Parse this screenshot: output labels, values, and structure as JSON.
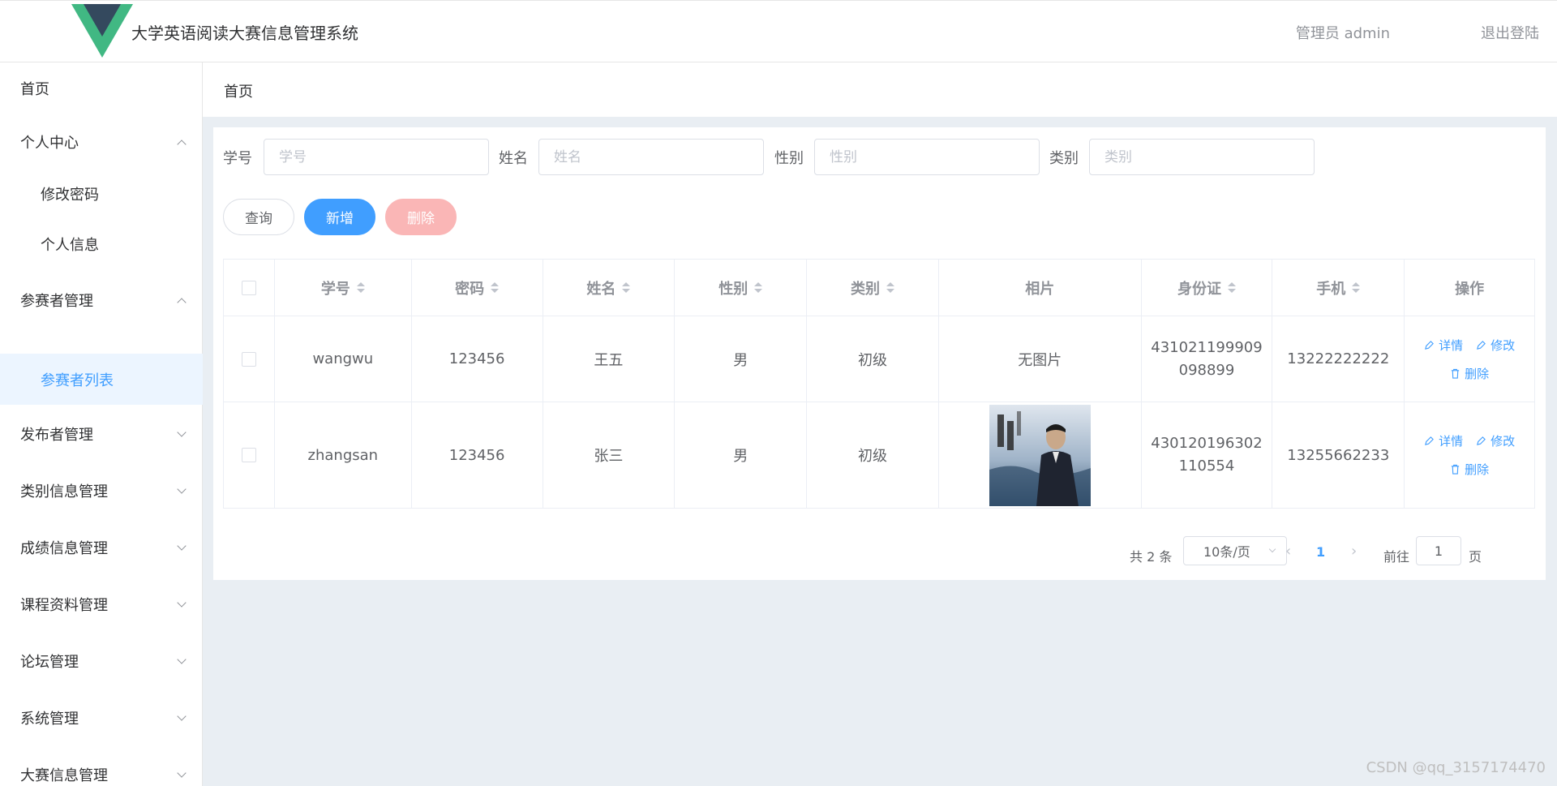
{
  "header": {
    "title": "大学英语阅读大赛信息管理系统",
    "admin_label": "管理员 admin",
    "logout_label": "退出登陆",
    "logo_colors": {
      "outer": "#41b883",
      "inner": "#34495e"
    }
  },
  "sidebar": {
    "items": [
      {
        "label": "首页"
      },
      {
        "label": "个人中心"
      },
      {
        "label": "修改密码"
      },
      {
        "label": "个人信息"
      },
      {
        "label": "参赛者管理"
      },
      {
        "label": "参赛者列表"
      },
      {
        "label": "发布者管理"
      },
      {
        "label": "类别信息管理"
      },
      {
        "label": "成绩信息管理"
      },
      {
        "label": "课程资料管理"
      },
      {
        "label": "论坛管理"
      },
      {
        "label": "系统管理"
      },
      {
        "label": "大赛信息管理"
      }
    ]
  },
  "breadcrumb": "首页",
  "filters": {
    "xuehao": {
      "label": "学号",
      "placeholder": "学号"
    },
    "xingming": {
      "label": "姓名",
      "placeholder": "姓名"
    },
    "xingbie": {
      "label": "性别",
      "placeholder": "性别"
    },
    "leibie": {
      "label": "类别",
      "placeholder": "类别"
    }
  },
  "buttons": {
    "query": "查询",
    "add": "新增",
    "delete": "删除"
  },
  "table": {
    "headers": [
      "学号",
      "密码",
      "姓名",
      "性别",
      "类别",
      "相片",
      "身份证",
      "手机",
      "操作"
    ],
    "rows": [
      {
        "xuehao": "wangwu",
        "mima": "123456",
        "xingming": "王五",
        "xingbie": "男",
        "leibie": "初级",
        "photo_text": "无图片",
        "idcard": "431021199909098899",
        "phone": "13222222222"
      },
      {
        "xuehao": "zhangsan",
        "mima": "123456",
        "xingming": "张三",
        "xingbie": "男",
        "leibie": "初级",
        "photo_text": "",
        "idcard": "430120196302110554",
        "phone": "13255662233"
      }
    ],
    "ops": {
      "detail": "详情",
      "edit": "修改",
      "delete": "删除"
    }
  },
  "pagination": {
    "total_label": "共 2 条",
    "page_size": "10条/页",
    "current_page": "1",
    "goto_label": "前往",
    "goto_value": "1",
    "page_unit": "页"
  },
  "watermark": "CSDN @qq_3157174470",
  "colors": {
    "primary": "#409eff",
    "danger_light": "#fab6b6",
    "active_bg": "#ecf5ff"
  }
}
